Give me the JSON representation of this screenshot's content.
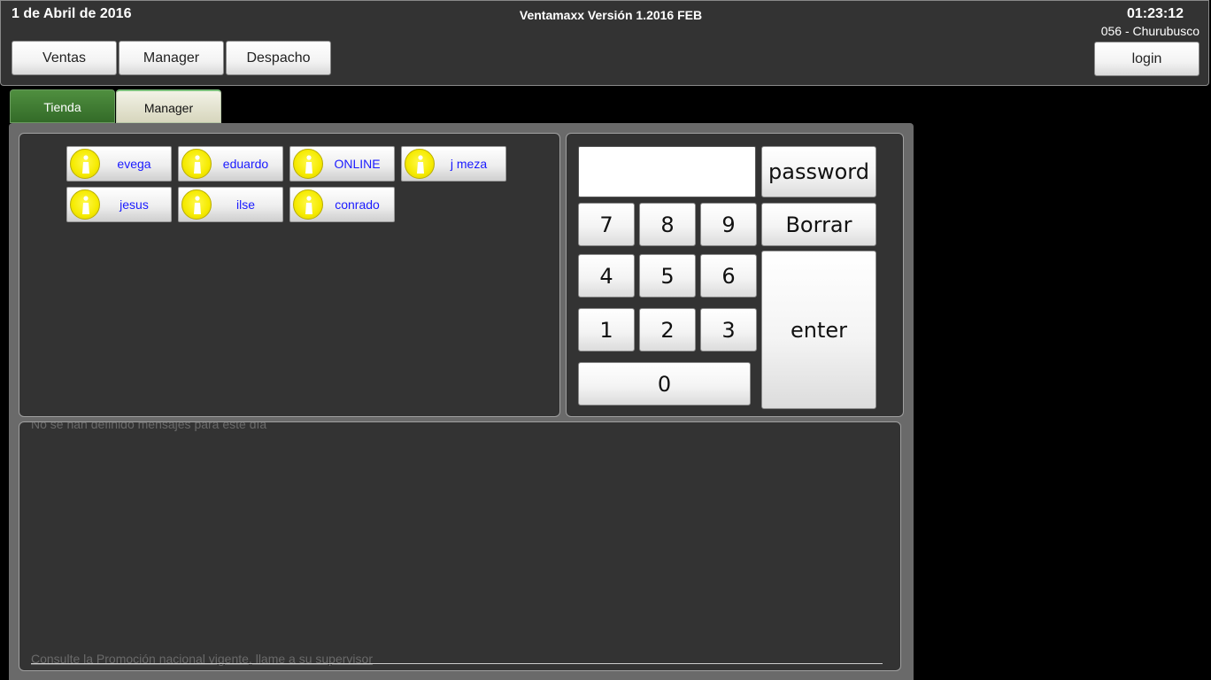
{
  "header": {
    "date": "1 de Abril de 2016",
    "title": "Ventamaxx Versión 1.2016 FEB",
    "time": "01:23:12",
    "store": "056 - Churubusco",
    "buttons": {
      "ventas": "Ventas",
      "manager": "Manager",
      "despacho": "Despacho",
      "login": "login"
    }
  },
  "tabs": [
    {
      "label": "Tienda",
      "active": false
    },
    {
      "label": "Manager",
      "active": true
    }
  ],
  "users": [
    {
      "name": "evega"
    },
    {
      "name": "eduardo"
    },
    {
      "name": "ONLINE"
    },
    {
      "name": "j meza"
    },
    {
      "name": "jesus"
    },
    {
      "name": "ilse"
    },
    {
      "name": "conrado"
    }
  ],
  "keypad": {
    "input_value": "",
    "password_label": "password",
    "clear_label": "Borrar",
    "enter_label": "enter",
    "digits": [
      "7",
      "8",
      "9",
      "4",
      "5",
      "6",
      "1",
      "2",
      "3",
      "0"
    ]
  },
  "messages": {
    "partial_text": "No se han definido mensajes para este día",
    "footer": "Consulte la Promoción nacional vigente, llame a su supervisor"
  },
  "colors": {
    "background": "#000000",
    "panel": "#333333",
    "tab_active_green": "#336b28",
    "user_name_blue": "#1a1aff",
    "avatar_yellow": "#f5ea00"
  }
}
